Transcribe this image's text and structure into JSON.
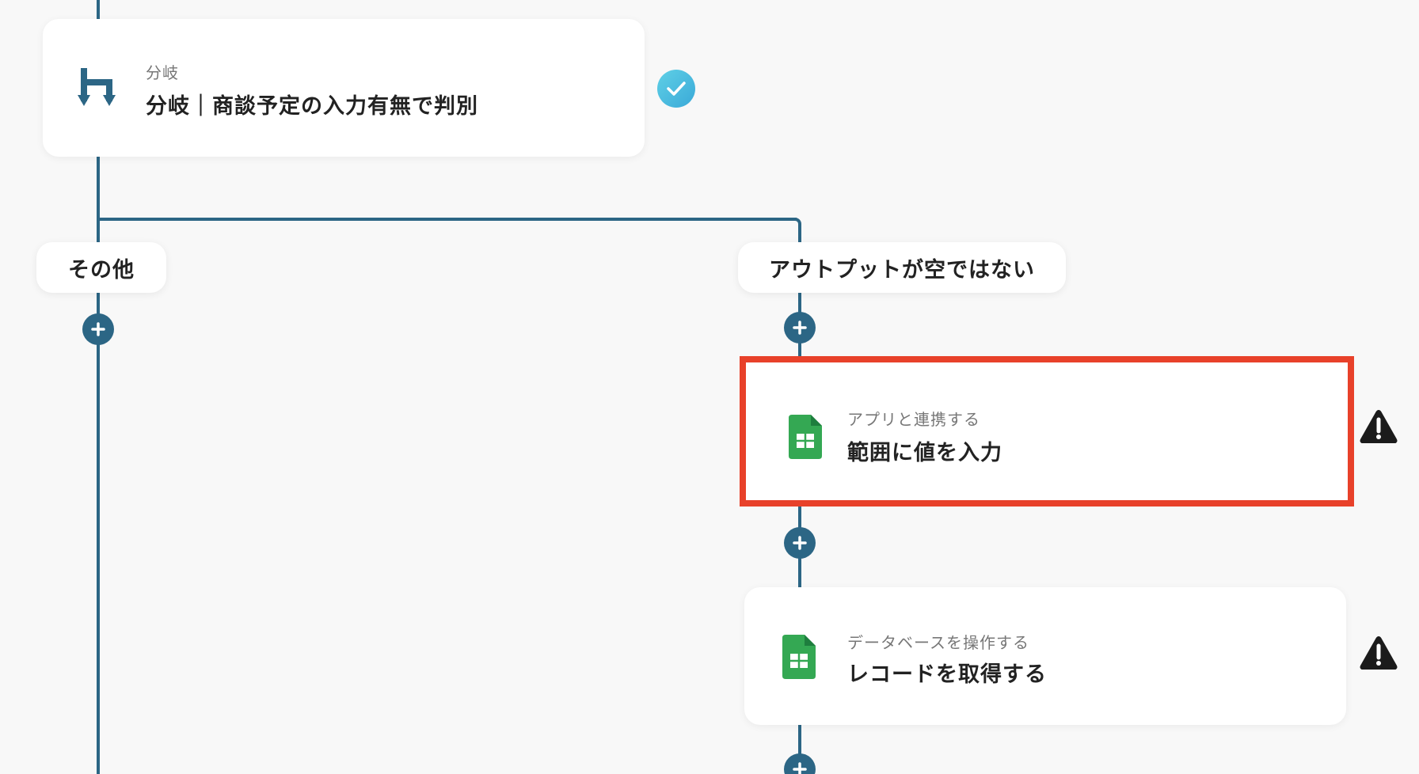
{
  "branch_card": {
    "subtitle": "分岐",
    "title": "分岐｜商談予定の入力有無で判別",
    "icon": "branch-icon",
    "status": "check-icon"
  },
  "branches": {
    "left_label": "その他",
    "right_label": "アウトプットが空ではない"
  },
  "step_cards": [
    {
      "subtitle": "アプリと連携する",
      "title": "範囲に値を入力",
      "icon": "google-sheets-icon",
      "status": "warning-icon",
      "selected": true
    },
    {
      "subtitle": "データベースを操作する",
      "title": "レコードを取得する",
      "icon": "google-sheets-icon",
      "status": "warning-icon",
      "selected": false
    }
  ],
  "colors": {
    "connector": "#2c6685",
    "selected_outline": "#e8412a",
    "sheets_green": "#34a853",
    "check_gradient": "#3aa9d8"
  }
}
